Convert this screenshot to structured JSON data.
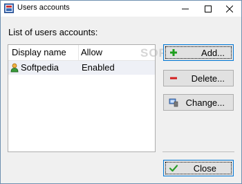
{
  "window": {
    "title": "Users accounts"
  },
  "label": "List of users accounts:",
  "table": {
    "columns": [
      "Display name",
      "Allow"
    ],
    "rows": [
      {
        "name": "Softpedia",
        "allow": "Enabled"
      }
    ]
  },
  "buttons": {
    "add": "Add...",
    "delete": "Delete...",
    "change": "Change...",
    "close": "Close"
  },
  "watermark": "SOFTPEDIA",
  "colors": {
    "accent": "#0078d7",
    "add": "#1e9e1e",
    "delete": "#d42020",
    "close_check": "#2a9d2a"
  }
}
